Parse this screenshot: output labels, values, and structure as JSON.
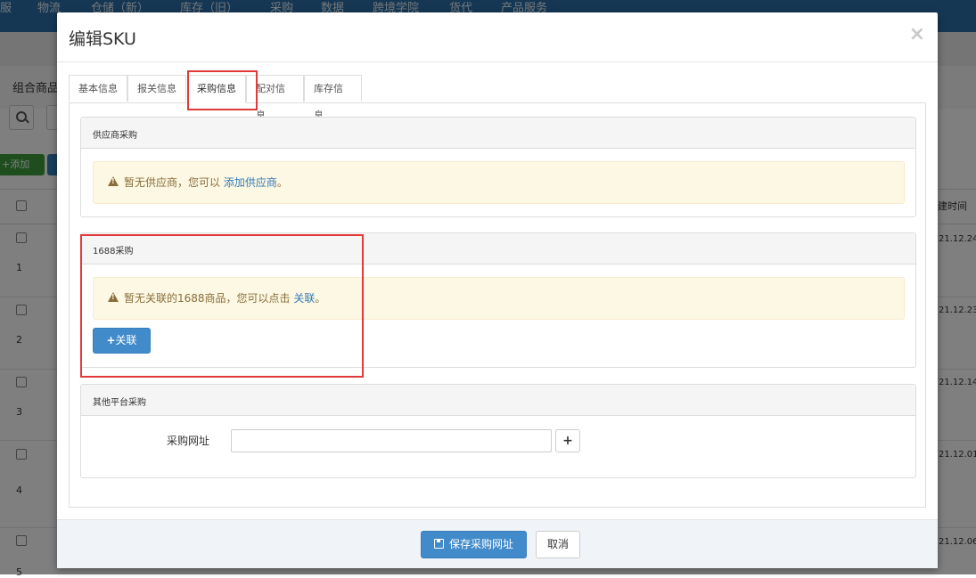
{
  "background": {
    "nav_items": [
      "服",
      "物流",
      "仓储（新）",
      "库存（旧）",
      "采购",
      "数据",
      "跨境学院",
      "货代",
      "产品服务"
    ],
    "breadcrumb": "组合商品",
    "add_button": "+添加",
    "column_right": "建时间",
    "rows": [
      {
        "num": "1",
        "date": "21.12.24"
      },
      {
        "num": "2",
        "date": "21.12.23"
      },
      {
        "num": "3",
        "date": "21.12.14"
      },
      {
        "num": "4",
        "date": "21.12.01"
      },
      {
        "num": "5",
        "date": "21.12.06"
      }
    ]
  },
  "modal": {
    "title": "编辑SKU",
    "close": "×",
    "tabs": [
      {
        "label": "基本信息",
        "active": false
      },
      {
        "label": "报关信息",
        "active": false
      },
      {
        "label": "采购信息",
        "active": true
      },
      {
        "label": "配对信息",
        "active": false
      },
      {
        "label": "库存信息",
        "active": false
      }
    ],
    "supplier_panel": {
      "title": "供应商采购",
      "alert_text": "暂无供应商，您可以",
      "alert_link": "添加供应商",
      "alert_suffix": "。"
    },
    "panel_1688": {
      "title": "1688采购",
      "alert_text": "暂无关联的1688商品，您可以点击",
      "alert_link": "关联",
      "alert_suffix": "。",
      "button": "关联"
    },
    "other_panel": {
      "title": "其他平台采购",
      "field_label": "采购网址",
      "field_value": "",
      "field_placeholder": "",
      "add_button": "+"
    },
    "footer": {
      "save_button": "保存采购网址",
      "cancel_button": "取消"
    }
  },
  "colors": {
    "primary": "#428bca",
    "warning_bg": "#fcf8e3",
    "warning_text": "#8a6d3b",
    "highlight_box": "#e03a3a",
    "nav_bg": "#2a6fa8"
  }
}
